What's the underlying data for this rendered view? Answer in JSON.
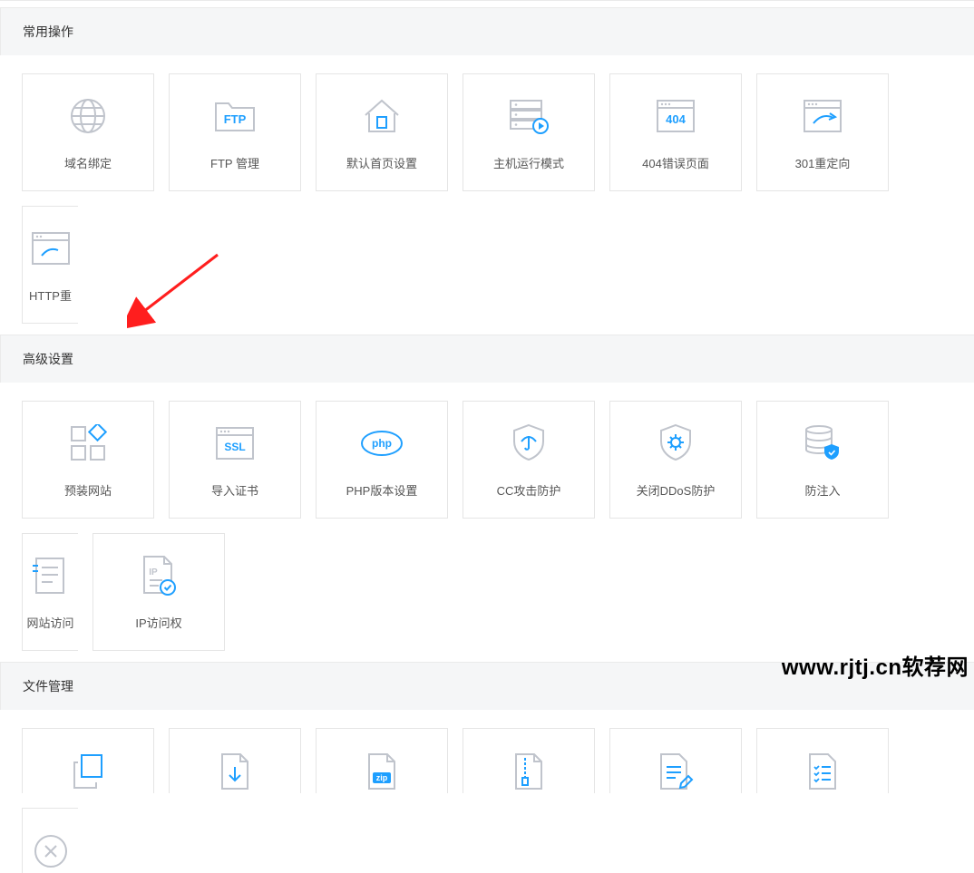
{
  "sections": {
    "common": {
      "title": "常用操作"
    },
    "advanced": {
      "title": "高级设置"
    },
    "files": {
      "title": "文件管理"
    }
  },
  "common_items": [
    {
      "id": "domain-bind",
      "label": "域名绑定"
    },
    {
      "id": "ftp-manage",
      "label": "FTP 管理"
    },
    {
      "id": "default-index",
      "label": "默认首页设置"
    },
    {
      "id": "run-mode",
      "label": "主机运行模式"
    },
    {
      "id": "error-404",
      "label": "404错误页面"
    },
    {
      "id": "redirect-301",
      "label": "301重定向"
    },
    {
      "id": "http-redirect",
      "label": "HTTP重"
    }
  ],
  "advanced_items": [
    {
      "id": "preinstall-site",
      "label": "预装网站"
    },
    {
      "id": "import-cert",
      "label": "导入证书"
    },
    {
      "id": "php-version",
      "label": "PHP版本设置"
    },
    {
      "id": "cc-protect",
      "label": "CC攻击防护"
    },
    {
      "id": "ddos-off",
      "label": "关闭DDoS防护"
    },
    {
      "id": "anti-inject",
      "label": "防注入"
    },
    {
      "id": "site-access",
      "label": "网站访问"
    },
    {
      "id": "ip-access",
      "label": "IP访问权"
    }
  ],
  "file_items": [
    {
      "id": "file-copy",
      "label": ""
    },
    {
      "id": "file-download",
      "label": ""
    },
    {
      "id": "file-zip",
      "label": ""
    },
    {
      "id": "file-compress",
      "label": ""
    },
    {
      "id": "file-edit",
      "label": ""
    },
    {
      "id": "file-list",
      "label": ""
    },
    {
      "id": "file-delete",
      "label": ""
    }
  ],
  "icons": {
    "ftp_text": "FTP",
    "ssl_text": "SSL",
    "php_text": "php",
    "zip_text": "zip",
    "ip_text": "IP",
    "error_text": "404"
  },
  "watermark": "www.rjtj.cn软荐网",
  "colors": {
    "accent": "#1e9fff",
    "muted": "#c0c4cc",
    "border": "#d8d8d8"
  }
}
